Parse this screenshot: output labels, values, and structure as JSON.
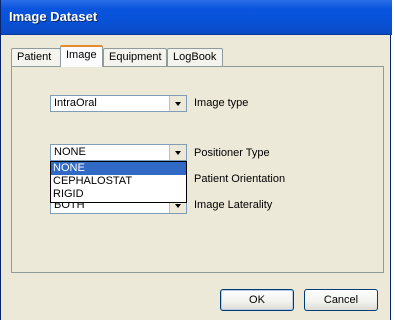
{
  "window": {
    "title": "Image Dataset"
  },
  "tabs": [
    {
      "label": "Patient",
      "active": false
    },
    {
      "label": "Image",
      "active": true
    },
    {
      "label": "Equipment",
      "active": false
    },
    {
      "label": "LogBook",
      "active": false
    }
  ],
  "fields": {
    "image_type": {
      "value": "IntraOral",
      "label": "Image type"
    },
    "positioner_type": {
      "value": "NONE",
      "label": "Positioner Type"
    },
    "patient_orientation": {
      "label": "Patient Orientation"
    },
    "image_laterality": {
      "value": "BOTH",
      "label": "Image Laterality"
    }
  },
  "dropdown": {
    "options": [
      "NONE",
      "CEPHALOSTAT",
      "RIGID"
    ],
    "selected": "NONE"
  },
  "buttons": {
    "ok": "OK",
    "cancel": "Cancel"
  },
  "colors": {
    "titlebar": "#0a55de",
    "selection": "#316ac5",
    "active_tab_accent": "#e68b2c"
  },
  "icons": [
    "chevron-down-icon"
  ]
}
